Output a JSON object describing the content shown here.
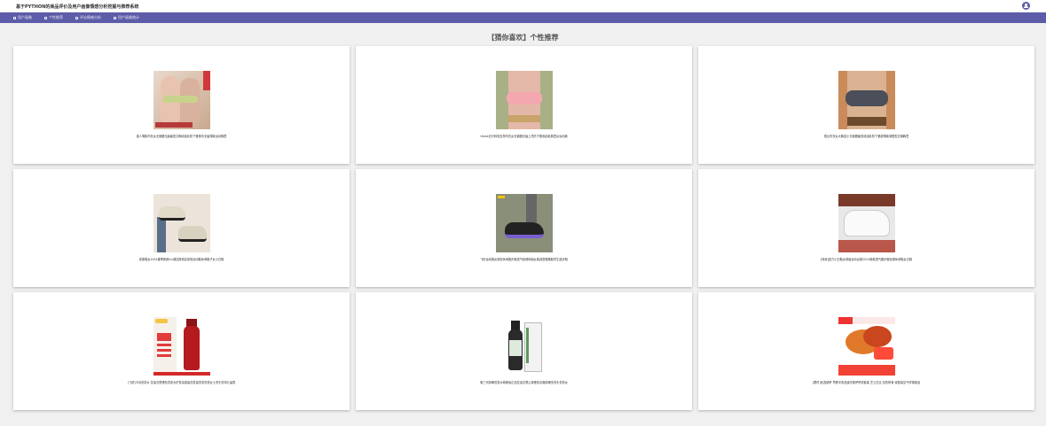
{
  "app": {
    "title": "基于PYTHON的商品评价及用户画像情感分析挖掘与推荐系统"
  },
  "nav": [
    {
      "label": "用户画像"
    },
    {
      "label": "个性推荐"
    },
    {
      "label": "评论情感分析"
    },
    {
      "label": "用户画像统计"
    }
  ],
  "section": {
    "title": "【猜你喜欢】个性推荐"
  },
  "products": [
    {
      "caption": "猫人薄款内衣女无钢圈无痕聚拢文胸收副乳防下垂美背无痕薄款运动胸罩",
      "image": "bra-pink-green"
    },
    {
      "caption": "Ubras无尺码软支撑内衣女无钢圈无痕上托防下垂收副乳胸罩女运动款",
      "image": "bra-pink"
    },
    {
      "caption": "蕾丝内衣女大胸显小无钢圈聚拢收副乳防下垂超薄款调整型文胸胸罩",
      "image": "bra-grey"
    },
    {
      "caption": "老爹鞋女2024春季新款ins潮百搭增高厚底运动鞋休闲鞋子女小白鞋",
      "image": "shoe-beige"
    },
    {
      "caption": "飞织运动鞋女软底休闲跑步鞋透气轻便网面女鞋减震慢跑鞋学生健步鞋",
      "image": "shoe-black-purple"
    },
    {
      "caption": "[特卖]回力小白鞋女网面运动女鞋2024新款透气跑步鞋轻便休闲鞋女白鞋",
      "image": "shoe-white"
    },
    {
      "caption": "[飞跃]卡诗洗发水 控油去屑蓬松洗发水护发素套装洗发露洗发膏男女士洗头膏持久留香",
      "image": "shampoo-red"
    },
    {
      "caption": "第三代除螨洗发水硫磺皂正品控油去屑止痒蓬松清爽除螨虫洗头膏男女",
      "image": "bottle-black"
    },
    {
      "caption": "[限时]优选披萨 早餐半成品速冻披萨饼底套装 芝士拉丝 加热即食 家庭装空气炸锅食品",
      "image": "food-pizza"
    }
  ]
}
